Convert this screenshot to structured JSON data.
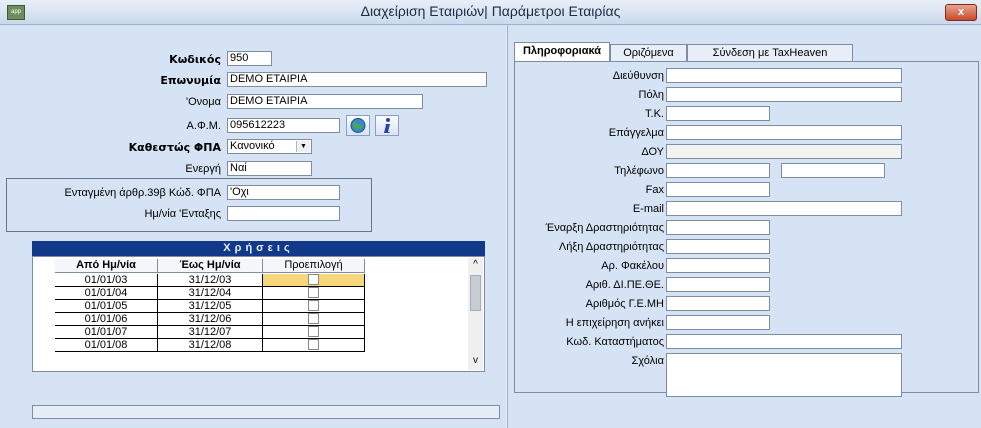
{
  "window": {
    "title": "Διαχείριση Εταιριών| Παράμετροι Εταιρίας",
    "app_icon_text": "app",
    "close_label": "x"
  },
  "company": {
    "code_label": "Κωδικός",
    "code_value": "950",
    "name_label": "Επωνυμία",
    "name_value": "DEMO ΕΤΑΙΡΙΑ",
    "short_label": "'Ονομα",
    "short_value": "DEMO ΕΤΑΙΡΙΑ",
    "afm_label": "Α.Φ.Μ.",
    "afm_value": "095612223",
    "vat_status_label": "Καθεστώς ΦΠΑ",
    "vat_status_value": "Κανονικό",
    "active_label": "Ενεργή",
    "active_value": "Ναί",
    "integrated_label": "Ενταγμένη άρθρ.39β Κώδ. ΦΠΑ",
    "integrated_value": "'Οχι",
    "integration_date_label": "Ημ/νία 'Ενταξης",
    "integration_date_value": ""
  },
  "usages": {
    "header": "Χρήσεις",
    "columns": [
      "Από Ημ/νία",
      "Έως Ημ/νία",
      "Προεπιλογή"
    ],
    "rows": [
      {
        "from": "01/01/03",
        "to": "31/12/03"
      },
      {
        "from": "01/01/04",
        "to": "31/12/04"
      },
      {
        "from": "01/01/05",
        "to": "31/12/05"
      },
      {
        "from": "01/01/06",
        "to": "31/12/06"
      },
      {
        "from": "01/01/07",
        "to": "31/12/07"
      },
      {
        "from": "01/01/08",
        "to": "31/12/08"
      }
    ],
    "scroll_up": "^",
    "scroll_down": "v"
  },
  "tabs": [
    "Πληροφοριακά",
    "Οριζόμενα",
    "Σύνδεση με TaxHeaven"
  ],
  "info": {
    "address": "Διεύθυνση",
    "city": "Πόλη",
    "zip": "Τ.Κ.",
    "profession": "Επάγγελμα",
    "doy": "ΔΟΥ",
    "phone": "Τηλέφωνο",
    "fax": "Fax",
    "email": "E-mail",
    "start": "Έναρξη Δραστηριότητας",
    "end": "Λήξη Δραστηριότητας",
    "folder": "Αρ. Φακέλου",
    "dipethe": "Αριθ. ΔΙ.ΠΕ.ΘΕ.",
    "gemh": "Αριθμός Γ.Ε.ΜΗ",
    "belongs": "Η επιχείρηση ανήκει",
    "store_code": "Κωδ. Καταστήματος",
    "comments": "Σχόλια"
  },
  "colors": {
    "grid_header": "#12388a",
    "selected_cell": "#f8d67c"
  }
}
